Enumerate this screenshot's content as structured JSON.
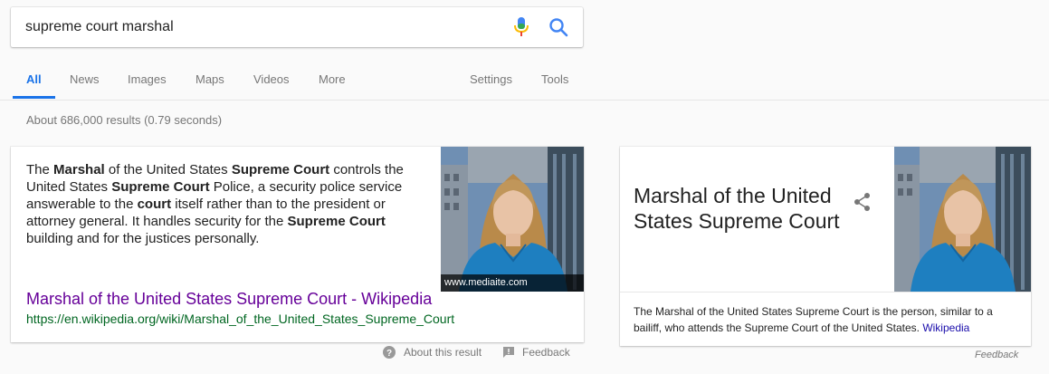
{
  "search": {
    "query": "supreme court marshal"
  },
  "tabs": {
    "all": "All",
    "news": "News",
    "images": "Images",
    "maps": "Maps",
    "videos": "Videos",
    "more": "More",
    "settings": "Settings",
    "tools": "Tools"
  },
  "stats": "About 686,000 results (0.79 seconds)",
  "featured": {
    "snippet": [
      {
        "t": "The ",
        "b": false
      },
      {
        "t": "Marshal",
        "b": true
      },
      {
        "t": " of the United States ",
        "b": false
      },
      {
        "t": "Supreme Court",
        "b": true
      },
      {
        "t": " controls the United States ",
        "b": false
      },
      {
        "t": "Supreme Court",
        "b": true
      },
      {
        "t": " Police, a security police service answerable to the ",
        "b": false
      },
      {
        "t": "court",
        "b": true
      },
      {
        "t": " itself rather than to the president or attorney general. It handles security for the ",
        "b": false
      },
      {
        "t": "Supreme Court",
        "b": true
      },
      {
        "t": " building and for the justices personally.",
        "b": false
      }
    ],
    "image_caption": "www.mediaite.com",
    "title": "Marshal of the United States Supreme Court - Wikipedia",
    "url": "https://en.wikipedia.org/wiki/Marshal_of_the_United_States_Supreme_Court",
    "about_label": "About this result",
    "feedback_label": "Feedback"
  },
  "knowledge_panel": {
    "title": "Marshal of the United States Supreme Court",
    "description": "The Marshal of the United States Supreme Court is the person, similar to a bailiff, who attends the Supreme Court of the United States.",
    "source_link": "Wikipedia",
    "feedback_label": "Feedback"
  },
  "colors": {
    "accent": "#1a73e8",
    "visited_link": "#660099",
    "url_green": "#006621",
    "link_blue": "#1a0dab"
  }
}
